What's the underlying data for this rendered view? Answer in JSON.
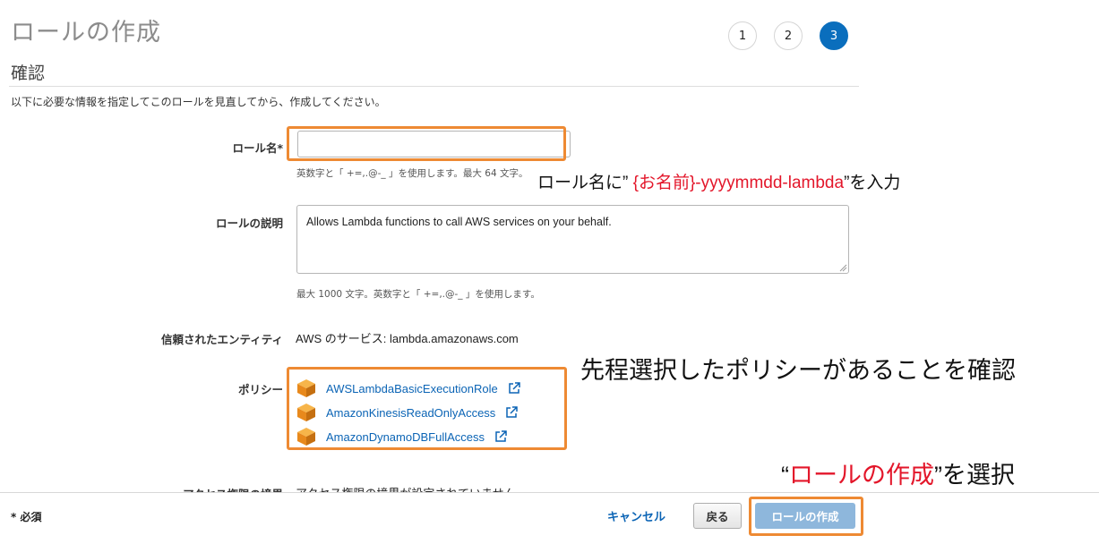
{
  "header": {
    "title": "ロールの作成",
    "steps": [
      "1",
      "2",
      "3"
    ],
    "active_step": "3"
  },
  "section": {
    "title": "確認",
    "intro": "以下に必要な情報を指定してこのロールを見直してから、作成してください。"
  },
  "form": {
    "role_name_label": "ロール名*",
    "role_name_value": "",
    "role_name_hint": "英数字と「 +=,.@-_ 」を使用します。最大 64 文字。",
    "role_desc_label": "ロールの説明",
    "role_desc_value": "Allows Lambda functions to call AWS services on your behalf.",
    "role_desc_hint": "最大 1000 文字。英数字と「 +=,.@-_ 」を使用します。",
    "trusted_label": "信頼されたエンティティ",
    "trusted_value": "AWS のサービス: lambda.amazonaws.com",
    "policies_label": "ポリシー",
    "policies": [
      "AWSLambdaBasicExecutionRole",
      "AmazonKinesisReadOnlyAccess",
      "AmazonDynamoDBFullAccess"
    ],
    "boundary_label": "アクセス権限の境界",
    "boundary_value": "アクセス権限の境界が設定されていません"
  },
  "annotations": {
    "name_prefix": "ロール名に” ",
    "name_red": "{お名前}-yyyymmdd-lambda",
    "name_suffix": "”を入力",
    "policy_note": "先程選択したポリシーがあることを確認",
    "create_prefix": "“",
    "create_red": "ロールの作成",
    "create_suffix": "”を選択"
  },
  "footer": {
    "required_note": "* 必須",
    "cancel_label": "キャンセル",
    "back_label": "戻る",
    "create_label": "ロールの作成"
  },
  "colors": {
    "accent_blue": "#0a6ebd",
    "link_blue": "#0b64b5",
    "highlight_orange": "#ee8a33",
    "annotation_red": "#e3162a",
    "aws_orange": "#f29a1f"
  },
  "icons": {
    "policy": "aws-cube-icon",
    "external": "external-link-icon"
  }
}
